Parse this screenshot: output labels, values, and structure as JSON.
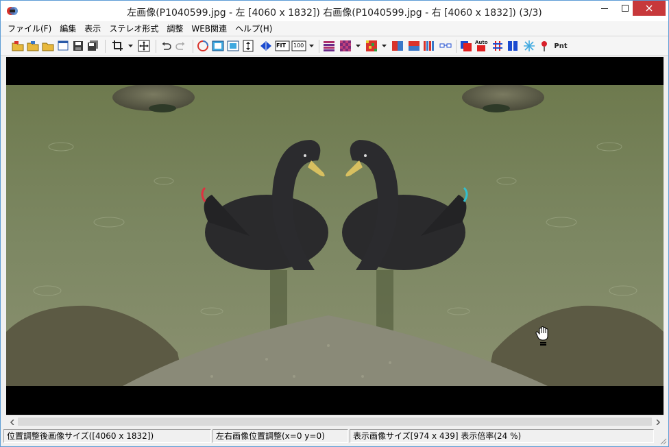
{
  "window": {
    "title": "左画像(P1040599.jpg - 左 [4060 x 1832]) 右画像(P1040599.jpg - 右 [4060 x 1832])  (3/3)"
  },
  "menu": {
    "items": [
      "ファイル(F)",
      "編集",
      "表示",
      "ステレオ形式",
      "調整",
      "WEB関連",
      "ヘルプ(H)"
    ]
  },
  "toolbar": {
    "fit_label": "FIT",
    "zoom100_label": "100",
    "auto_label": "Auto",
    "pnt_label": "Pnt"
  },
  "status": {
    "adjusted_size": "位置調整後画像サイズ([4060 x 1832])",
    "lr_adjust": "左右画像位置調整(x=0 y=0)",
    "display_size": "表示画像サイズ[974 x 439]  表示倍率(24 %)"
  },
  "colors": {
    "close_button": "#c7383b",
    "water": "#7d8a62",
    "background_black": "#000000"
  }
}
